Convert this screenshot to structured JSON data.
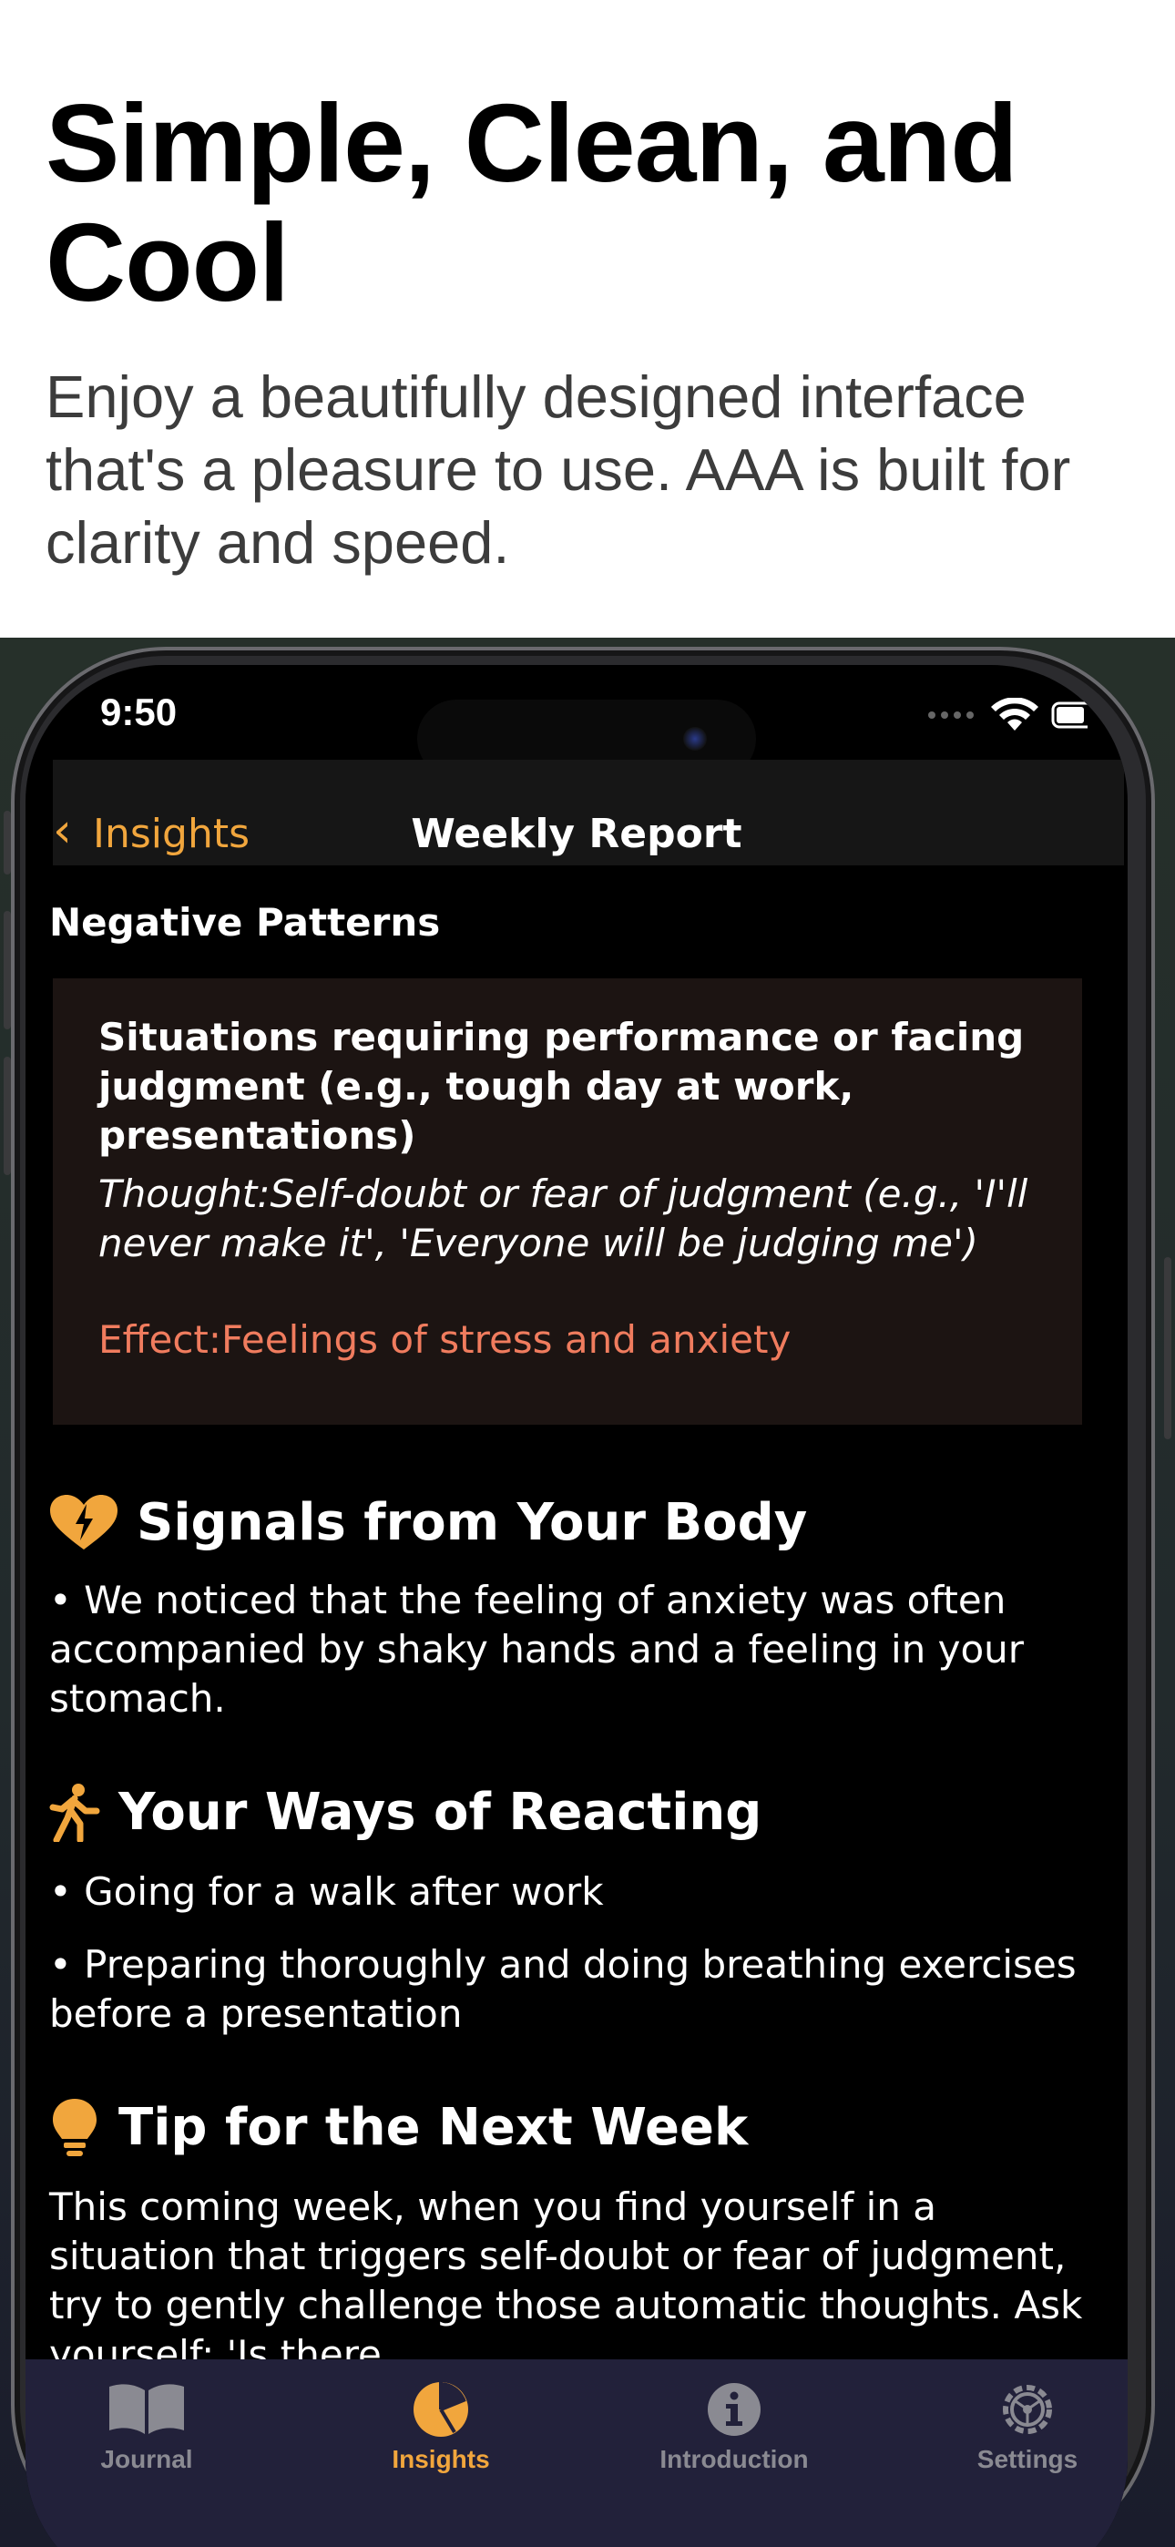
{
  "hero": {
    "title": "Simple, Clean, and Cool",
    "subtitle": "Enjoy a beautifully designed interface that's a pleasure to use. AAA is built for clarity and speed."
  },
  "status_bar": {
    "time": "9:50"
  },
  "nav": {
    "back_label": "Insights",
    "title": "Weekly Report"
  },
  "negative_patterns": {
    "label": "Negative Patterns",
    "situation": "Situations requiring performance or facing judgment (e.g., tough day at work, presentations)",
    "thought": "Thought:Self-doubt or fear of judgment (e.g., 'I'll never make it', 'Everyone will be judging me')",
    "effect": "Effect:Feelings of stress and anxiety"
  },
  "body_signals": {
    "title": "Signals from Your Body",
    "items": [
      "• We noticed that the feeling of anxiety was often accompanied by shaky hands and a feeling in your stomach."
    ]
  },
  "reacting": {
    "title": "Your Ways of Reacting",
    "items": [
      "• Going for a walk after work",
      "• Preparing thoroughly and doing breathing exercises before a presentation"
    ]
  },
  "tip": {
    "title": "Tip for the Next Week",
    "text": "This coming week, when you find yourself in a situation that triggers self-doubt or fear of judgment, try to gently challenge those automatic thoughts. Ask yourself: 'Is there"
  },
  "tabs": [
    {
      "label": "Journal",
      "icon": "book-icon",
      "active": false
    },
    {
      "label": "Insights",
      "icon": "pie-chart-icon",
      "active": true
    },
    {
      "label": "Introduction",
      "icon": "info-icon",
      "active": false
    },
    {
      "label": "Settings",
      "icon": "gear-icon",
      "active": false
    }
  ],
  "colors": {
    "accent": "#f1a63d",
    "effect": "#f07c5e",
    "card_bg": "#1c1412",
    "tabbar_bg": "#22213a",
    "screen_bg": "#000000"
  }
}
